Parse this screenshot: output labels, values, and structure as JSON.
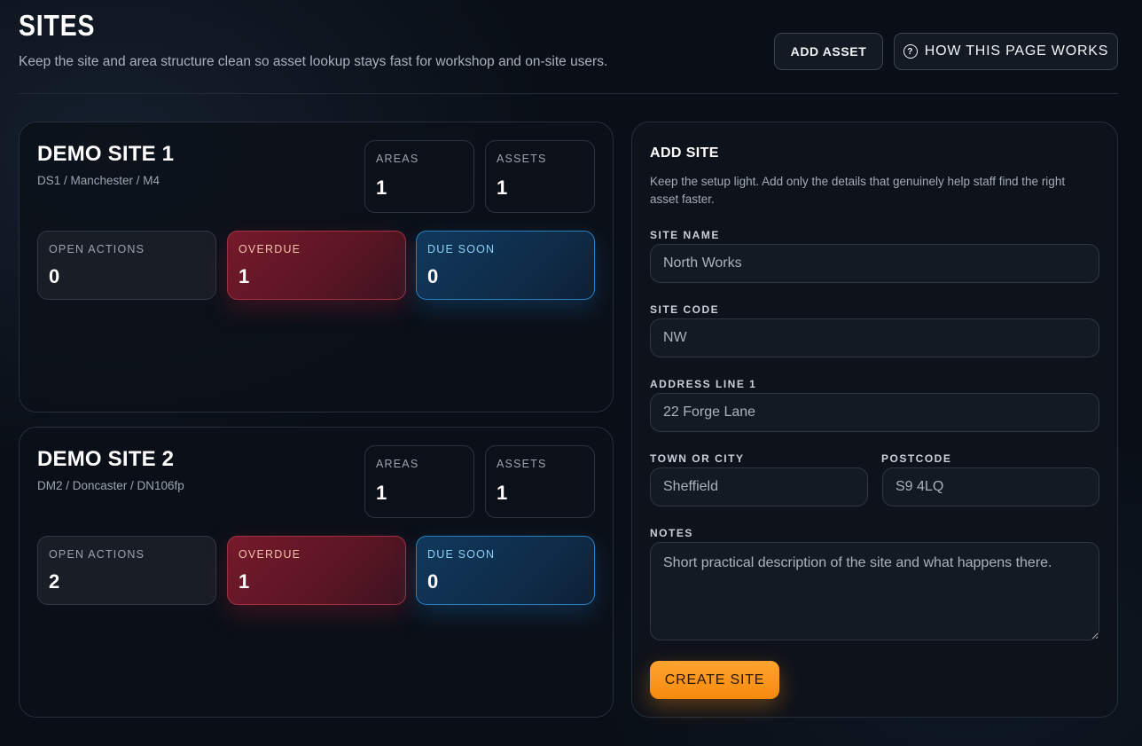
{
  "header": {
    "title": "SITES",
    "subtitle": "Keep the site and area structure clean so asset lookup stays fast for workshop and on-site users.",
    "add_asset_label": "ADD ASSET",
    "help_label": "HOW THIS PAGE WORKS"
  },
  "stat_labels": {
    "areas": "AREAS",
    "assets": "ASSETS",
    "open_actions": "OPEN ACTIONS",
    "overdue": "OVERDUE",
    "due_soon": "DUE SOON"
  },
  "sites": [
    {
      "name": "DEMO SITE 1",
      "meta": "DS1 / Manchester / M4",
      "areas": "1",
      "assets": "1",
      "open_actions": "0",
      "overdue": "1",
      "due_soon": "0"
    },
    {
      "name": "DEMO SITE 2",
      "meta": "DM2 / Doncaster / DN106fp",
      "areas": "1",
      "assets": "1",
      "open_actions": "2",
      "overdue": "1",
      "due_soon": "0"
    }
  ],
  "form": {
    "title": "ADD SITE",
    "description": "Keep the setup light. Add only the details that genuinely help staff find the right asset faster.",
    "site_name_label": "SITE NAME",
    "site_name_placeholder": "North Works",
    "site_code_label": "SITE CODE",
    "site_code_placeholder": "NW",
    "address_label": "ADDRESS LINE 1",
    "address_placeholder": "22 Forge Lane",
    "town_label": "TOWN OR CITY",
    "town_placeholder": "Sheffield",
    "postcode_label": "POSTCODE",
    "postcode_placeholder": "S9 4LQ",
    "notes_label": "NOTES",
    "notes_placeholder": "Short practical description of the site and what happens there.",
    "submit_label": "CREATE SITE"
  },
  "colors": {
    "accent": "#f7931a",
    "overdue": "#751a2c",
    "due_soon": "#10385c",
    "background": "#0a0f17"
  }
}
